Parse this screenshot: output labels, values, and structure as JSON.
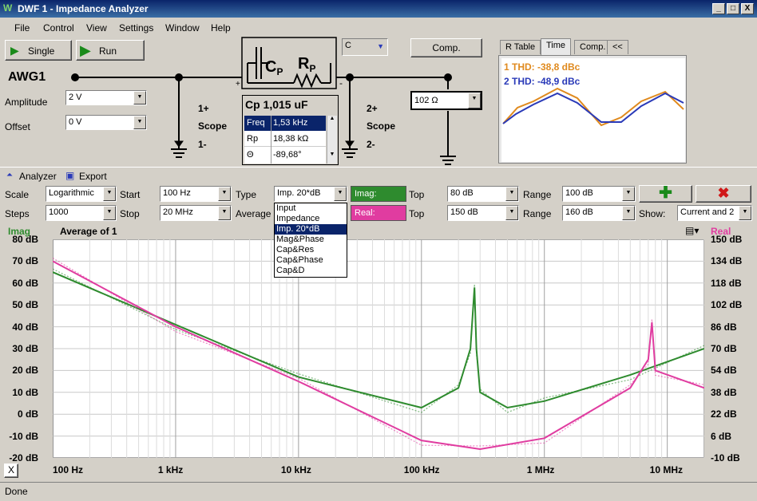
{
  "window": {
    "title": "DWF 1 - Impedance Analyzer",
    "min": "_",
    "max": "□",
    "close": "X"
  },
  "menu": [
    "File",
    "Control",
    "View",
    "Settings",
    "Window",
    "Help"
  ],
  "controls": {
    "single": "Single",
    "run": "Run",
    "awg": "AWG1",
    "amplitude_label": "Amplitude",
    "amplitude": "2 V",
    "offset_label": "Offset",
    "offset": "0 V",
    "comp": "Comp.",
    "component": "C",
    "load": "102 Ω"
  },
  "circuit": {
    "scope1p": "1+",
    "scope1": "Scope",
    "scope1m": "1-",
    "scope2p": "2+",
    "scope2": "Scope",
    "scope2m": "2-",
    "cp_value": "Cp 1,015 uF",
    "plus": "+",
    "minus": "-",
    "cp": "C",
    "cp_sub": "P",
    "rp": "R",
    "rp_sub": "P"
  },
  "readout": [
    {
      "k": "Freq",
      "v": "1,53 kHz"
    },
    {
      "k": "Rp",
      "v": "18,38 kΩ"
    },
    {
      "k": "Θ",
      "v": "-89,68°"
    }
  ],
  "tabs": [
    "R Table",
    "Time",
    "Comp.",
    "<<"
  ],
  "thd": {
    "ch1": "1 THD: -38,8 dBc",
    "ch2": "2 THD: -48,9 dBc",
    "c1": "#e08a1e",
    "c2": "#2a3ab8"
  },
  "toolbar": {
    "analyzer": "Analyzer",
    "export": "Export"
  },
  "settings": {
    "scale_label": "Scale",
    "scale": "Logarithmic",
    "start_label": "Start",
    "start": "100 Hz",
    "type_label": "Type",
    "type": "Imp. 20*dB",
    "steps_label": "Steps",
    "steps": "1000",
    "stop_label": "Stop",
    "stop": "20 MHz",
    "average_label": "Average",
    "imag": "Imag:",
    "real": "Real:",
    "top_label": "Top",
    "top1": "80 dB",
    "top2": "150 dB",
    "range_label": "Range",
    "range1": "100 dB",
    "range2": "160 dB",
    "show_label": "Show:",
    "show": "Current and 2"
  },
  "dropdown": [
    "Input",
    "Impedance",
    "Imp. 20*dB",
    "Mag&Phase",
    "Cap&Res",
    "Cap&Phase",
    "Cap&D"
  ],
  "plot": {
    "left_title": "Imag",
    "avg": "Average of 1",
    "right_title": "Real",
    "x_button": "X",
    "imag_color": "#2e8b2e",
    "real_color": "#e03ca0"
  },
  "yleft": [
    "80 dB",
    "70 dB",
    "60 dB",
    "50 dB",
    "40 dB",
    "30 dB",
    "20 dB",
    "10 dB",
    "0 dB",
    "-10 dB",
    "-20 dB"
  ],
  "yright": [
    "150 dB",
    "134 dB",
    "118 dB",
    "102 dB",
    "86 dB",
    "70 dB",
    "54 dB",
    "38 dB",
    "22 dB",
    "6 dB",
    "-10 dB"
  ],
  "xticks": [
    "100 Hz",
    "1 kHz",
    "10 kHz",
    "100 kHz",
    "1 MHz",
    "10 MHz"
  ],
  "status": "Done",
  "chart_data": {
    "type": "line",
    "xscale": "log",
    "xlim": [
      100,
      20000000
    ],
    "ylim_left": [
      -20,
      80
    ],
    "ylim_right": [
      -10,
      150
    ],
    "series": [
      {
        "name": "Imag",
        "x": [
          100,
          1000,
          10000,
          100000,
          200000,
          250000,
          270000,
          280000,
          300000,
          500000,
          1000000,
          5000000,
          20000000
        ],
        "values": [
          65,
          41,
          17,
          3,
          12,
          30,
          58,
          30,
          10,
          3,
          6,
          18,
          30
        ]
      },
      {
        "name": "Real",
        "x": [
          100,
          1000,
          10000,
          100000,
          300000,
          1000000,
          5000000,
          7000000,
          7500000,
          8000000,
          20000000
        ],
        "values": [
          70,
          40,
          15,
          -12,
          -16,
          -11,
          12,
          25,
          42,
          20,
          12
        ]
      }
    ]
  }
}
